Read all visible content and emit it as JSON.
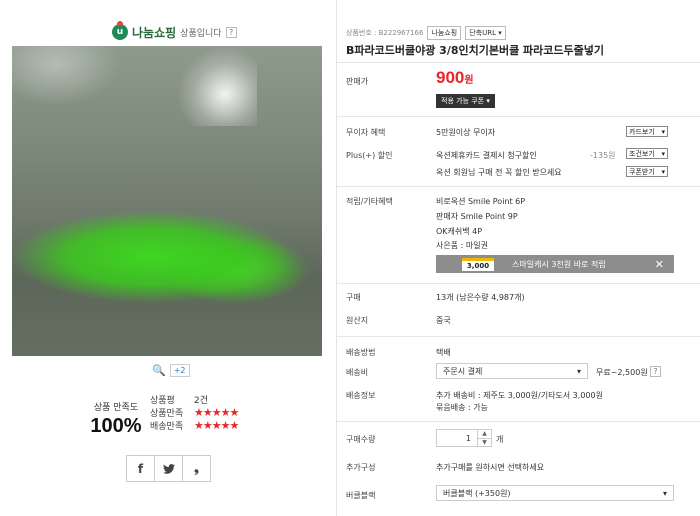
{
  "seller": {
    "name": "나눔쇼핑",
    "suffix": "상품입니다",
    "help": "?"
  },
  "gallery": {
    "zoom_icon": "search-icon",
    "more_count": "+2"
  },
  "satisfaction": {
    "label": "상품 만족도",
    "value": "100%",
    "rows": [
      {
        "label": "상품평",
        "value": "2건"
      },
      {
        "label": "상품만족",
        "stars": "★★★★★"
      },
      {
        "label": "배송만족",
        "stars": "★★★★★"
      }
    ]
  },
  "share": {
    "facebook": "f",
    "twitter": "𝕥",
    "other": "❟"
  },
  "product": {
    "number": "상품번호 : B222967166",
    "shop_button": "나눔쇼핑",
    "short_url": "단축URL",
    "title": "B파라코드버클야광 3/8인치기본버클 파라코드두줄넣기"
  },
  "price": {
    "label": "판매가",
    "value": "900",
    "unit": "원",
    "coupon": "적용 가능 쿠폰"
  },
  "benefits": {
    "free_ship_label": "무이자 혜택",
    "free_ship_value": "5만원이상 무이자",
    "free_ship_btn": "카드보기",
    "plus_label": "Plus(+) 할인",
    "plus_line1": "옥션제휴카드 결제시 청구할인",
    "plus_line1_amount": "-135원",
    "plus_line1_btn": "조건보기",
    "plus_line2": "옥션 회원님 구매 전 꼭 할인 받으세요",
    "plus_line2_btn": "쿠폰받기"
  },
  "points": {
    "label": "적립/기타혜택",
    "lines": [
      "비로옥션 Smile Point 6P",
      "판매자 Smile Point 9P",
      "OK캐쉬백 4P",
      "사은품 : 마일권"
    ],
    "smile_card": "3,000",
    "smile_text": "스마일캐시 3천원 바로 적립"
  },
  "purchase": {
    "count_label": "구매",
    "count_value": "13개 (남은수량 4,987개)",
    "origin_label": "원산지",
    "origin_value": "중국"
  },
  "shipping": {
    "method_label": "배송방법",
    "method_value": "택배",
    "fee_label": "배송비",
    "fee_select": "주문시 결제",
    "fee_value": "무료~2,500원",
    "info_label": "배송정보",
    "info_line1": "추가 배송비 : 제주도 3,000원/기타도서 3,000원",
    "info_line2": "묶음배송 : 가능"
  },
  "order": {
    "qty_label": "구매수량",
    "qty_value": "1",
    "qty_unit": "개",
    "extra_label": "추가구성",
    "extra_value": "추가구매를 원하시면 선택하세요",
    "buckle_label": "버클블랙",
    "buckle_select": "버클블랙 (+350원)"
  }
}
